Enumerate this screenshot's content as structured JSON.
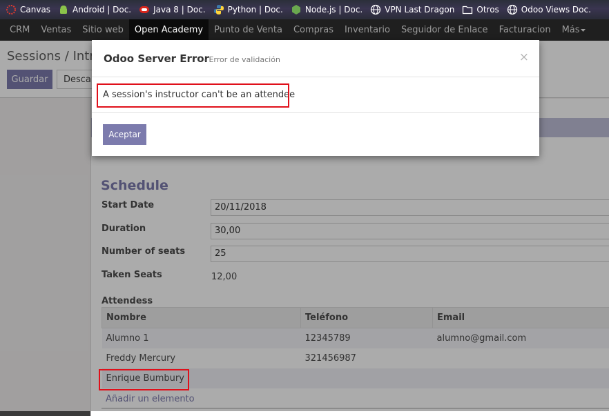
{
  "bookmarks": [
    {
      "label": "Canvas",
      "icon": "canvas-icon"
    },
    {
      "label": "Android | Doc.",
      "icon": "android-icon"
    },
    {
      "label": "Java 8 | Doc.",
      "icon": "java-icon"
    },
    {
      "label": "Python | Doc.",
      "icon": "python-icon"
    },
    {
      "label": "Node.js | Doc.",
      "icon": "nodejs-icon"
    },
    {
      "label": "VPN Last Dragon",
      "icon": "globe-icon"
    },
    {
      "label": "Otros",
      "icon": "folder-icon"
    },
    {
      "label": "Odoo Views Doc.",
      "icon": "globe-icon"
    }
  ],
  "nav": {
    "items": [
      "CRM",
      "Ventas",
      "Sitio web",
      "Open Academy",
      "Punto de Venta",
      "Compras",
      "Inventario",
      "Seguidor de Enlace",
      "Facturacion"
    ],
    "active": "Open Academy",
    "more": "Más"
  },
  "breadcrumb": "Sessions /  Intro",
  "buttons": {
    "save": "Guardar",
    "discard": "Descartar"
  },
  "schedule": {
    "title": "Schedule",
    "start_date_label": "Start Date",
    "start_date_value": "20/11/2018",
    "duration_label": "Duration",
    "duration_value": "30,00",
    "seats_label": "Number of seats",
    "seats_value": "25",
    "taken_label": "Taken Seats",
    "taken_value": "12,00"
  },
  "attendees": {
    "label": "Attendess",
    "columns": [
      "Nombre",
      "Teléfono",
      "Email"
    ],
    "rows": [
      {
        "name": "Alumno 1",
        "phone": "12345789",
        "email": "alumno@gmail.com"
      },
      {
        "name": "Freddy Mercury",
        "phone": "321456987",
        "email": ""
      },
      {
        "name": "Enrique Bumbury",
        "phone": "",
        "email": ""
      }
    ],
    "add": "Añadir un elemento"
  },
  "modal": {
    "title": "Odoo Server Error",
    "subtitle": "- Error de validación",
    "close": "×",
    "message": "A session's instructor can't be an attendee",
    "accept": "Aceptar"
  },
  "colors": {
    "accent": "#7c7bad",
    "highlight": "#e0101a",
    "nav_bg": "#1f1f1f"
  }
}
